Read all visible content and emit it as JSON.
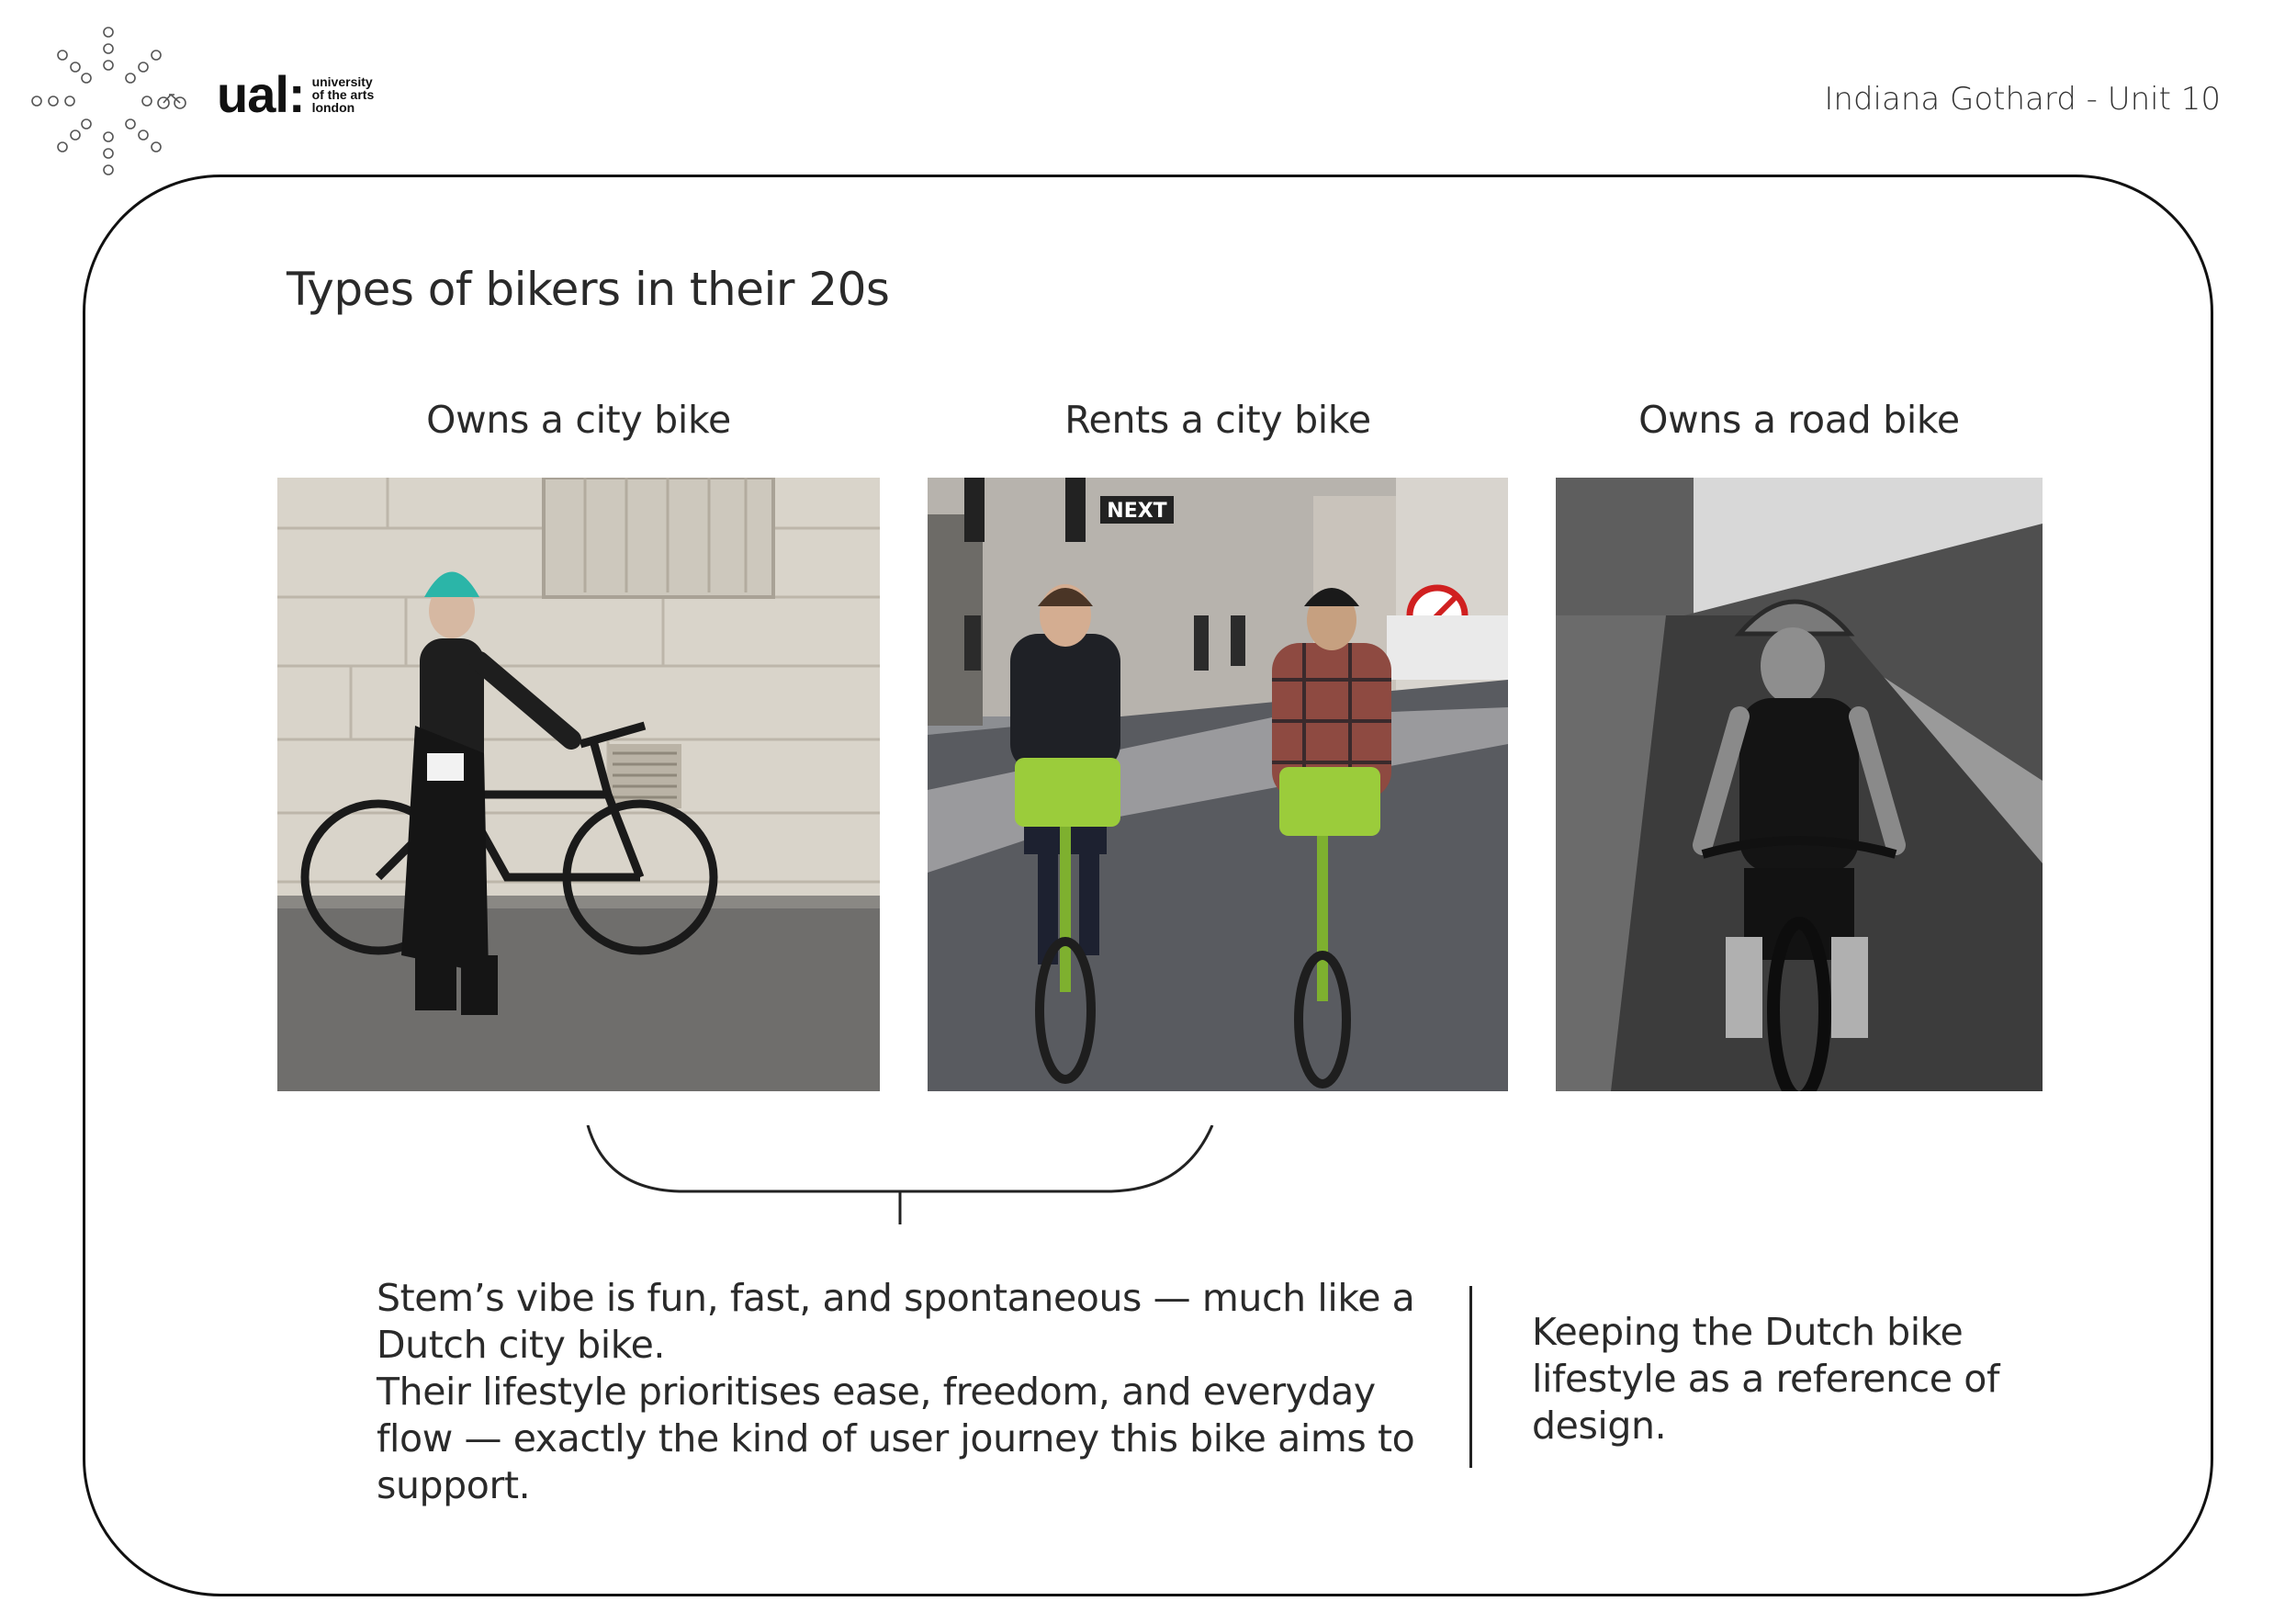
{
  "header": {
    "brand_mark": "ual:",
    "brand_sub": [
      "university",
      "of the arts",
      "london"
    ],
    "author_line": "Indiana Gothard - Unit 10"
  },
  "slide": {
    "title": "Types of bikers in their 20s",
    "columns": [
      {
        "label": "Owns a city bike",
        "image": "woman-with-black-city-bike-photo"
      },
      {
        "label": "Rents a city bike",
        "image": "two-riders-on-green-rental-ebikes-photo"
      },
      {
        "label": "Owns a road bike",
        "image": "cyclist-on-road-bike-bw-photo"
      }
    ],
    "street_sign_text": "NEXT",
    "body_lines": [
      "Stem’s vibe is fun, fast, and spontaneous — much like a Dutch city bike.",
      "Their lifestyle prioritises ease, freedom, and everyday flow — exactly the kind of user journey this bike aims to support."
    ],
    "side_note": "Keeping the Dutch bike lifestyle as a reference of design."
  },
  "colors": {
    "accent_green": "#9bcc3b",
    "beanie_teal": "#2bb5a8",
    "frame_stroke": "#111111"
  }
}
